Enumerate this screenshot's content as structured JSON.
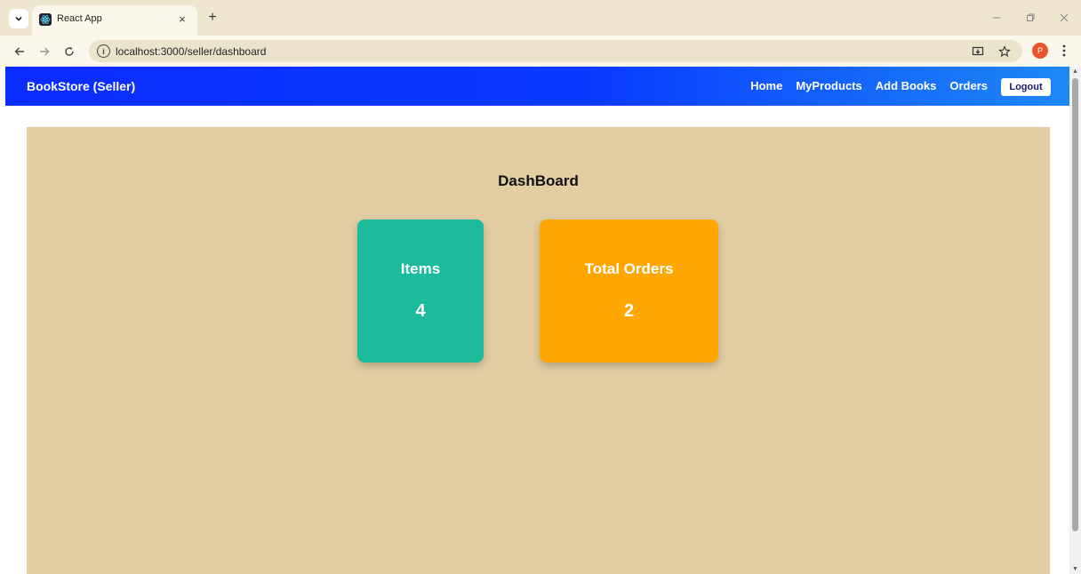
{
  "browser": {
    "tab_title": "React App",
    "tab_close": "×",
    "new_tab": "+",
    "url": "localhost:3000/seller/dashboard",
    "profile_initial": "P",
    "icons": {
      "tab_menu": "chevron-down-icon",
      "favicon": "react-logo-icon",
      "back": "back-arrow-icon",
      "forward": "forward-arrow-icon",
      "reload": "reload-icon",
      "site_info": "info-icon",
      "install": "install-app-icon",
      "bookmark": "star-icon",
      "menu": "kebab-menu-icon",
      "minimize": "minimize-icon",
      "restore": "restore-icon",
      "close": "close-icon"
    }
  },
  "navbar": {
    "brand": "BookStore (Seller)",
    "links": [
      "Home",
      "MyProducts",
      "Add Books",
      "Orders"
    ],
    "logout": "Logout",
    "gradient_colors": [
      "#0b2cff",
      "#1e88f5"
    ]
  },
  "dashboard": {
    "title": "DashBoard",
    "background": "#e3cea4",
    "cards": [
      {
        "label": "Items",
        "value": "4",
        "color": "#1cbb9c"
      },
      {
        "label": "Total Orders",
        "value": "2",
        "color": "#ffa600"
      }
    ]
  }
}
